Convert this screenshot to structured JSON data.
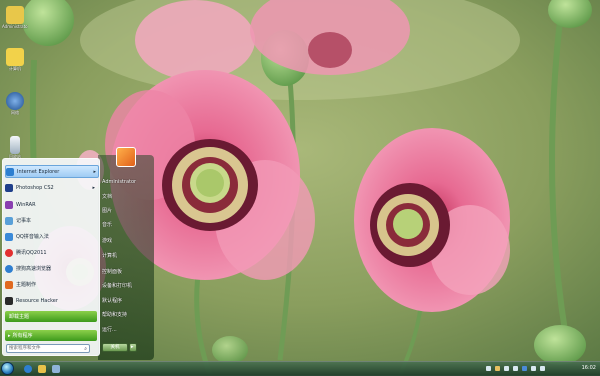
{
  "desktop": {
    "icons": [
      {
        "label": "Administrator",
        "icon": "user-folder-icon",
        "color": "#e8c74a"
      },
      {
        "label": "计算机",
        "icon": "folder-icon",
        "color": "#f2d24a"
      },
      {
        "label": "网络",
        "icon": "network-globe-icon",
        "color": "#3a6ab0"
      },
      {
        "label": "回收站",
        "icon": "recycle-bin-icon",
        "color": "#dfe6ee"
      }
    ]
  },
  "start_menu": {
    "programs": [
      {
        "label": "Internet Explorer",
        "icon": "ie-icon",
        "color": "#2d7fd0",
        "has_arrow": true
      },
      {
        "label": "Photoshop CS2",
        "icon": "photoshop-icon",
        "color": "#1f3f8a",
        "has_arrow": true
      },
      {
        "label": "WinRAR",
        "icon": "winrar-icon",
        "color": "#8a3fb0",
        "has_arrow": false
      },
      {
        "label": "记事本",
        "icon": "notepad-icon",
        "color": "#5aa0d8",
        "has_arrow": false
      },
      {
        "label": "QQ拼音输入法",
        "icon": "qq-pinyin-icon",
        "color": "#3b8ad8",
        "has_arrow": false
      },
      {
        "label": "腾讯QQ2011",
        "icon": "qq-icon",
        "color": "#e23030",
        "has_arrow": false
      },
      {
        "label": "搜狗高速浏览器",
        "icon": "sogou-browser-icon",
        "color": "#2f7fd0",
        "has_arrow": false
      },
      {
        "label": "主题制作",
        "icon": "theme-icon",
        "color": "#e06a20",
        "has_arrow": false
      },
      {
        "label": "Resource Hacker",
        "icon": "res-icon",
        "color": "#2a2a2a",
        "has_arrow": false
      }
    ],
    "pinned_highlight": "卸载主题",
    "all_programs": "所有程序",
    "search_placeholder": "搜索程序和文件",
    "user_name": "Administrator",
    "right_links": [
      "文档",
      "图片",
      "音乐",
      "游戏",
      "计算机",
      "控制面板",
      "设备和打印机",
      "默认程序",
      "帮助和支持",
      "运行..."
    ],
    "shutdown_label": "关机"
  },
  "taskbar": {
    "clock": "16:02"
  }
}
